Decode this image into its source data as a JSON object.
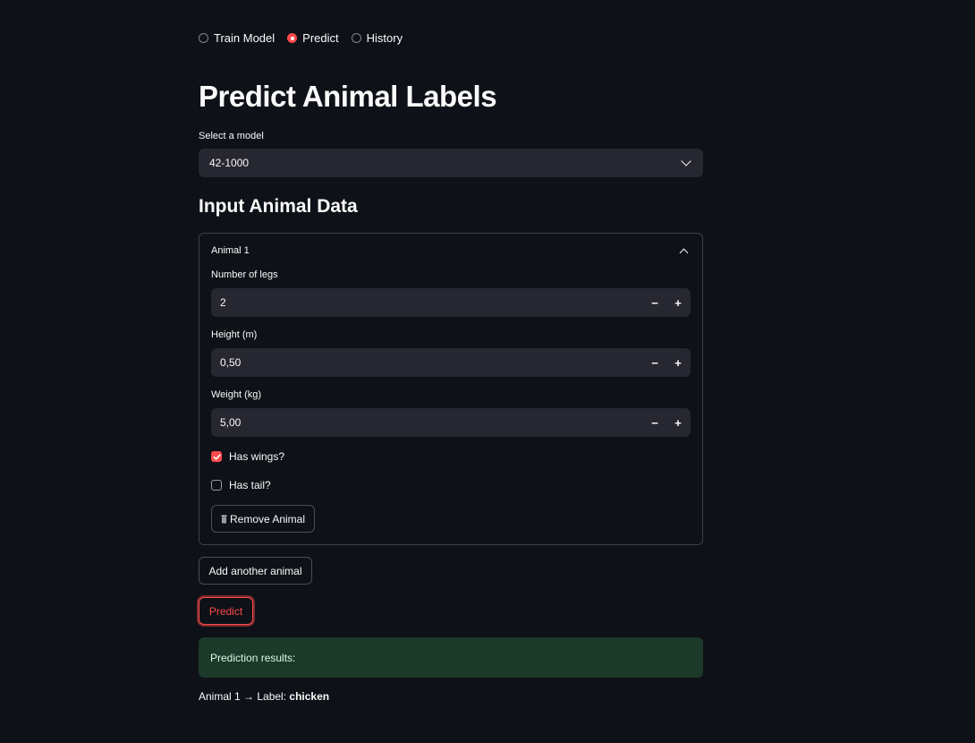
{
  "nav": {
    "options": [
      "Train Model",
      "Predict",
      "History"
    ],
    "selected": "Predict"
  },
  "page_title": "Predict Animal Labels",
  "model_select": {
    "label": "Select a model",
    "value": "42-1000"
  },
  "section_heading": "Input Animal Data",
  "animal": {
    "header": "Animal 1",
    "legs": {
      "label": "Number of legs",
      "value": "2"
    },
    "height": {
      "label": "Height (m)",
      "value": "0,50"
    },
    "weight": {
      "label": "Weight (kg)",
      "value": "5,00"
    },
    "has_wings": {
      "label": "Has wings?",
      "checked": true
    },
    "has_tail": {
      "label": "Has tail?",
      "checked": false
    },
    "remove_label": "Remove Animal"
  },
  "stepper": {
    "minus": "−",
    "plus": "+"
  },
  "add_button_label": "Add another animal",
  "predict_button_label": "Predict",
  "results": {
    "box_text": "Prediction results:",
    "line_prefix": "Animal 1 → Label: ",
    "label_value": "chicken"
  },
  "colors": {
    "background": "#0e1117",
    "accent": "#ff4b4b",
    "input_bg": "#262730",
    "success_bg": "#1b3a2a"
  },
  "icons": [
    "radio-icon",
    "chevron-down-icon",
    "chevron-up-icon",
    "minus-icon",
    "plus-icon",
    "check-icon",
    "trash-icon"
  ]
}
